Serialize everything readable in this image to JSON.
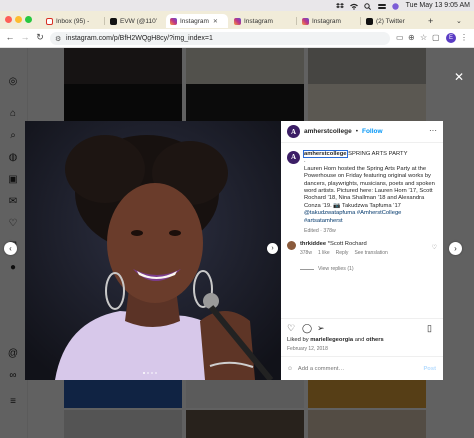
{
  "menubar": {
    "clock": "Tue May 13  9:05 AM"
  },
  "tabs": [
    {
      "label": "Inbox (95) - ",
      "favicon": "gmail-icon",
      "color": "#d93025"
    },
    {
      "label": "EVW (@110’",
      "favicon": "x-logo-icon",
      "color": "#111111"
    },
    {
      "label": "Instagram",
      "favicon": "instagram-icon",
      "color": "#c13584",
      "active": true
    },
    {
      "label": "Instagram",
      "favicon": "instagram-icon",
      "color": "#c13584"
    },
    {
      "label": "Instagram",
      "favicon": "instagram-icon",
      "color": "#c13584"
    },
    {
      "label": "(2) Twitter",
      "favicon": "x-logo-icon",
      "color": "#111111"
    }
  ],
  "address_bar": {
    "url": "instagram.com/p/BfH2WQgH8cy/?img_index=1",
    "profile_initial": "E"
  },
  "post": {
    "username": "amherstcollege",
    "follow_label": "Follow",
    "dot": "•",
    "caption_user": "amherstcollege",
    "caption_first": "SPRING ARTS PARTY",
    "caption_dash": ".",
    "caption_body": "Lauren Horn hosted the Spring Arts Party at the Powerhouse on Friday featuring original works by dancers, playwrights, musicians, poets and spoken word artists. Pictured here: Lauren Horn ’17, Scott Rochard ’18, Nina Shallman ’18 and Alexandra Conza ’19. 📷 Takudzwa Tapfuma ’17",
    "caption_tags": "@takudzwatapfuma #AmherstCollege #artsatamherst",
    "edited": "Edited · 378w",
    "comment": {
      "user": "thrkiddee",
      "text": "*Scott Rochard",
      "age": "378w",
      "likes": "1 like",
      "reply": "Reply",
      "see_translation": "See translation"
    },
    "view_replies": "View replies (1)",
    "liked_by_prefix": "Liked by",
    "liked_by_user": "mariellegeorgia",
    "liked_by_and": "and",
    "liked_by_others": "others",
    "date": "February 12, 2018",
    "add_comment_placeholder": "Add a comment…",
    "post_label": "Post"
  }
}
